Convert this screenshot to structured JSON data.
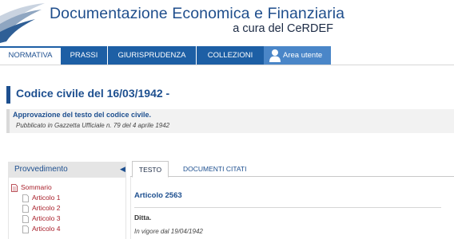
{
  "header": {
    "title": "Documentazione Economica e Finanziaria",
    "subtitle": "a cura del CeRDEF"
  },
  "nav": {
    "items": [
      {
        "label": "NORMATIVA",
        "active": true
      },
      {
        "label": "PRASSI"
      },
      {
        "label": "GIURISPRUDENZA"
      },
      {
        "label": "COLLEZIONI"
      }
    ],
    "user_area": "Area utente"
  },
  "document": {
    "title": "Codice civile del 16/03/1942 -",
    "approval": "Approvazione del testo del codice civile.",
    "gazzetta": "Pubblicato in Gazzetta Ufficiale n. 79 del 4 aprile 1942"
  },
  "sidebar": {
    "header": "Provvedimento",
    "items": [
      {
        "label": "Sommario",
        "level": 0
      },
      {
        "label": "Articolo 1",
        "level": 1
      },
      {
        "label": "Articolo 2",
        "level": 1
      },
      {
        "label": "Articolo 3",
        "level": 1
      },
      {
        "label": "Articolo 4",
        "level": 1
      }
    ]
  },
  "tabs": [
    {
      "label": "TESTO",
      "active": true
    },
    {
      "label": "DOCUMENTI CITATI"
    }
  ],
  "content": {
    "article_title": "Articolo 2563",
    "heading": "Ditta.",
    "in_force": "In vigore dal 19/04/1942"
  },
  "colors": {
    "brand_blue": "#1d5fa5",
    "title_blue": "#1d4f8f",
    "link_red": "#a8202b",
    "user_area_blue": "#4a86c8"
  }
}
